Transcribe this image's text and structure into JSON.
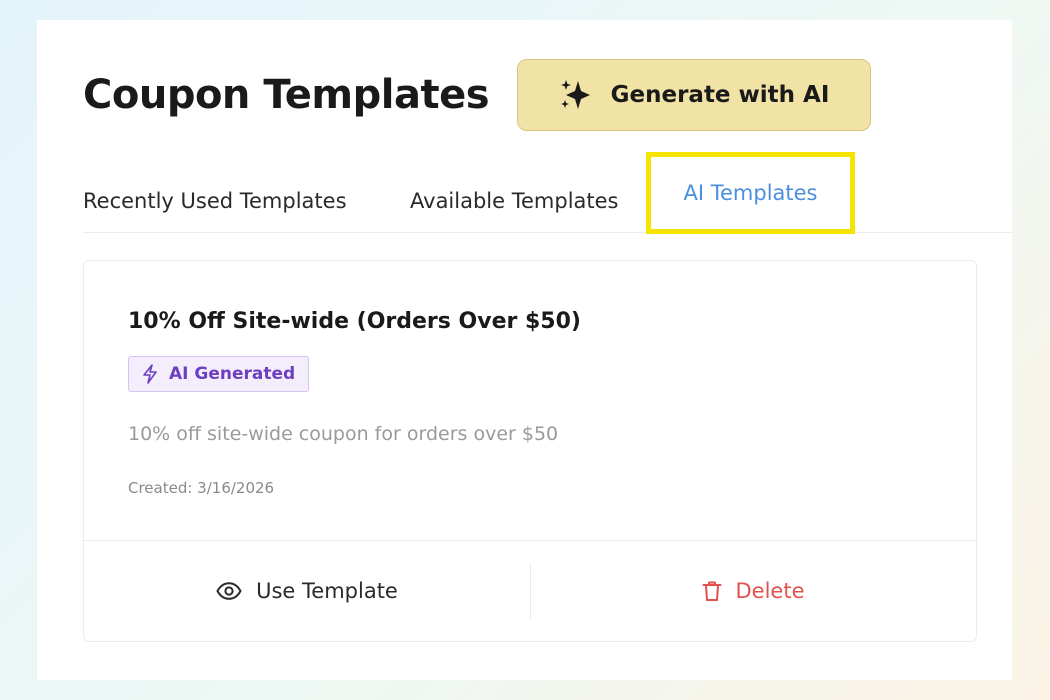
{
  "header": {
    "title": "Coupon Templates",
    "generate_button_label": "Generate with AI",
    "generate_button_icon": "sparkles-icon"
  },
  "tabs": [
    {
      "label": "Recently Used Templates",
      "active": false
    },
    {
      "label": "Available Templates",
      "active": false
    },
    {
      "label": "AI Templates",
      "active": true,
      "highlighted": true
    }
  ],
  "template_card": {
    "title": "10% Off Site-wide (Orders Over $50)",
    "badge": {
      "label": "AI Generated",
      "icon": "lightning-icon"
    },
    "description": "10% off site-wide coupon for orders over $50",
    "created": "Created: 3/16/2026",
    "actions": {
      "use_label": "Use Template",
      "use_icon": "eye-icon",
      "delete_label": "Delete",
      "delete_icon": "trash-icon"
    }
  },
  "colors": {
    "generate_button_bg": "#f1e3a6",
    "active_tab_text": "#4a8fe0",
    "highlight_outline": "#f5e400",
    "badge_bg": "#f4edfc",
    "badge_text": "#6d3fc1",
    "delete_text": "#e2524e"
  }
}
